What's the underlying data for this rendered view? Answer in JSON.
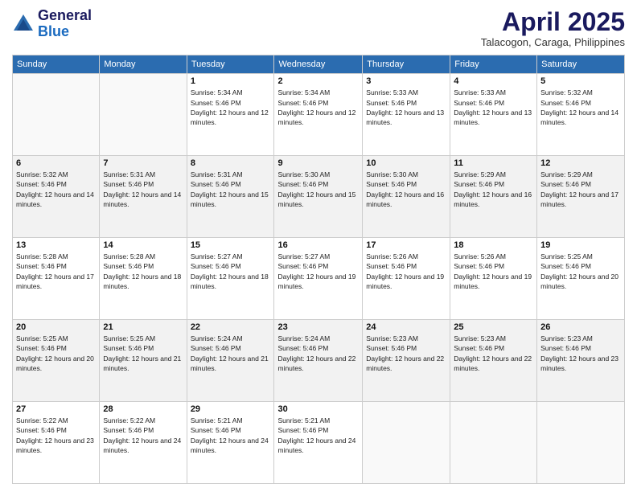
{
  "header": {
    "logo_general": "General",
    "logo_blue": "Blue",
    "month": "April 2025",
    "location": "Talacogon, Caraga, Philippines"
  },
  "days_of_week": [
    "Sunday",
    "Monday",
    "Tuesday",
    "Wednesday",
    "Thursday",
    "Friday",
    "Saturday"
  ],
  "weeks": [
    [
      {
        "day": "",
        "sunrise": "",
        "sunset": "",
        "daylight": ""
      },
      {
        "day": "",
        "sunrise": "",
        "sunset": "",
        "daylight": ""
      },
      {
        "day": "1",
        "sunrise": "Sunrise: 5:34 AM",
        "sunset": "Sunset: 5:46 PM",
        "daylight": "Daylight: 12 hours and 12 minutes."
      },
      {
        "day": "2",
        "sunrise": "Sunrise: 5:34 AM",
        "sunset": "Sunset: 5:46 PM",
        "daylight": "Daylight: 12 hours and 12 minutes."
      },
      {
        "day": "3",
        "sunrise": "Sunrise: 5:33 AM",
        "sunset": "Sunset: 5:46 PM",
        "daylight": "Daylight: 12 hours and 13 minutes."
      },
      {
        "day": "4",
        "sunrise": "Sunrise: 5:33 AM",
        "sunset": "Sunset: 5:46 PM",
        "daylight": "Daylight: 12 hours and 13 minutes."
      },
      {
        "day": "5",
        "sunrise": "Sunrise: 5:32 AM",
        "sunset": "Sunset: 5:46 PM",
        "daylight": "Daylight: 12 hours and 14 minutes."
      }
    ],
    [
      {
        "day": "6",
        "sunrise": "Sunrise: 5:32 AM",
        "sunset": "Sunset: 5:46 PM",
        "daylight": "Daylight: 12 hours and 14 minutes."
      },
      {
        "day": "7",
        "sunrise": "Sunrise: 5:31 AM",
        "sunset": "Sunset: 5:46 PM",
        "daylight": "Daylight: 12 hours and 14 minutes."
      },
      {
        "day": "8",
        "sunrise": "Sunrise: 5:31 AM",
        "sunset": "Sunset: 5:46 PM",
        "daylight": "Daylight: 12 hours and 15 minutes."
      },
      {
        "day": "9",
        "sunrise": "Sunrise: 5:30 AM",
        "sunset": "Sunset: 5:46 PM",
        "daylight": "Daylight: 12 hours and 15 minutes."
      },
      {
        "day": "10",
        "sunrise": "Sunrise: 5:30 AM",
        "sunset": "Sunset: 5:46 PM",
        "daylight": "Daylight: 12 hours and 16 minutes."
      },
      {
        "day": "11",
        "sunrise": "Sunrise: 5:29 AM",
        "sunset": "Sunset: 5:46 PM",
        "daylight": "Daylight: 12 hours and 16 minutes."
      },
      {
        "day": "12",
        "sunrise": "Sunrise: 5:29 AM",
        "sunset": "Sunset: 5:46 PM",
        "daylight": "Daylight: 12 hours and 17 minutes."
      }
    ],
    [
      {
        "day": "13",
        "sunrise": "Sunrise: 5:28 AM",
        "sunset": "Sunset: 5:46 PM",
        "daylight": "Daylight: 12 hours and 17 minutes."
      },
      {
        "day": "14",
        "sunrise": "Sunrise: 5:28 AM",
        "sunset": "Sunset: 5:46 PM",
        "daylight": "Daylight: 12 hours and 18 minutes."
      },
      {
        "day": "15",
        "sunrise": "Sunrise: 5:27 AM",
        "sunset": "Sunset: 5:46 PM",
        "daylight": "Daylight: 12 hours and 18 minutes."
      },
      {
        "day": "16",
        "sunrise": "Sunrise: 5:27 AM",
        "sunset": "Sunset: 5:46 PM",
        "daylight": "Daylight: 12 hours and 19 minutes."
      },
      {
        "day": "17",
        "sunrise": "Sunrise: 5:26 AM",
        "sunset": "Sunset: 5:46 PM",
        "daylight": "Daylight: 12 hours and 19 minutes."
      },
      {
        "day": "18",
        "sunrise": "Sunrise: 5:26 AM",
        "sunset": "Sunset: 5:46 PM",
        "daylight": "Daylight: 12 hours and 19 minutes."
      },
      {
        "day": "19",
        "sunrise": "Sunrise: 5:25 AM",
        "sunset": "Sunset: 5:46 PM",
        "daylight": "Daylight: 12 hours and 20 minutes."
      }
    ],
    [
      {
        "day": "20",
        "sunrise": "Sunrise: 5:25 AM",
        "sunset": "Sunset: 5:46 PM",
        "daylight": "Daylight: 12 hours and 20 minutes."
      },
      {
        "day": "21",
        "sunrise": "Sunrise: 5:25 AM",
        "sunset": "Sunset: 5:46 PM",
        "daylight": "Daylight: 12 hours and 21 minutes."
      },
      {
        "day": "22",
        "sunrise": "Sunrise: 5:24 AM",
        "sunset": "Sunset: 5:46 PM",
        "daylight": "Daylight: 12 hours and 21 minutes."
      },
      {
        "day": "23",
        "sunrise": "Sunrise: 5:24 AM",
        "sunset": "Sunset: 5:46 PM",
        "daylight": "Daylight: 12 hours and 22 minutes."
      },
      {
        "day": "24",
        "sunrise": "Sunrise: 5:23 AM",
        "sunset": "Sunset: 5:46 PM",
        "daylight": "Daylight: 12 hours and 22 minutes."
      },
      {
        "day": "25",
        "sunrise": "Sunrise: 5:23 AM",
        "sunset": "Sunset: 5:46 PM",
        "daylight": "Daylight: 12 hours and 22 minutes."
      },
      {
        "day": "26",
        "sunrise": "Sunrise: 5:23 AM",
        "sunset": "Sunset: 5:46 PM",
        "daylight": "Daylight: 12 hours and 23 minutes."
      }
    ],
    [
      {
        "day": "27",
        "sunrise": "Sunrise: 5:22 AM",
        "sunset": "Sunset: 5:46 PM",
        "daylight": "Daylight: 12 hours and 23 minutes."
      },
      {
        "day": "28",
        "sunrise": "Sunrise: 5:22 AM",
        "sunset": "Sunset: 5:46 PM",
        "daylight": "Daylight: 12 hours and 24 minutes."
      },
      {
        "day": "29",
        "sunrise": "Sunrise: 5:21 AM",
        "sunset": "Sunset: 5:46 PM",
        "daylight": "Daylight: 12 hours and 24 minutes."
      },
      {
        "day": "30",
        "sunrise": "Sunrise: 5:21 AM",
        "sunset": "Sunset: 5:46 PM",
        "daylight": "Daylight: 12 hours and 24 minutes."
      },
      {
        "day": "",
        "sunrise": "",
        "sunset": "",
        "daylight": ""
      },
      {
        "day": "",
        "sunrise": "",
        "sunset": "",
        "daylight": ""
      },
      {
        "day": "",
        "sunrise": "",
        "sunset": "",
        "daylight": ""
      }
    ]
  ]
}
